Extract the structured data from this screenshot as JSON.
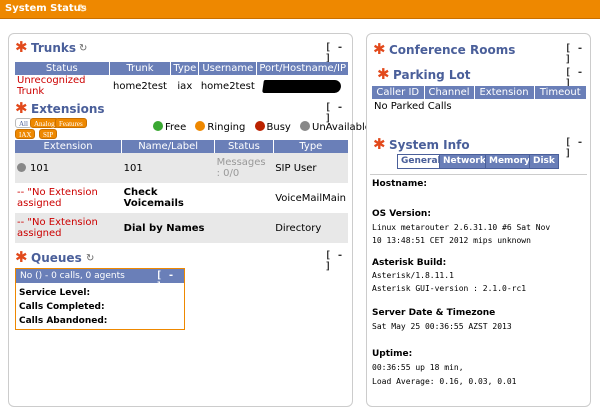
{
  "header": {
    "title": "System Status",
    "refresh_icon": "refresh-icon"
  },
  "trunks": {
    "title": "Trunks",
    "collapse_label": "[ - ]",
    "columns": [
      "Status",
      "Trunk",
      "Type",
      "Username",
      "Port/Hostname/IP"
    ],
    "rows": [
      {
        "status": "Unrecognized Trunk",
        "trunk": "home2test",
        "type": "iax",
        "username": "home2test",
        "host": ""
      }
    ],
    "status_color": "#cc0000"
  },
  "extensions": {
    "title": "Extensions",
    "collapse_label": "[ - ]",
    "filters": [
      "All",
      "Analog",
      "Features",
      "IAX",
      "SIP"
    ],
    "legend": [
      "Free",
      "Ringing",
      "Busy",
      "UnAvailable"
    ],
    "legend_colors": [
      "#3aa832",
      "#ee8800",
      "#bb2200",
      "#888888"
    ],
    "columns": [
      "Extension",
      "Name/Label",
      "Status",
      "Type"
    ],
    "rows": [
      {
        "extension": "101",
        "name": "101",
        "status": "Messages : 0/0",
        "type": "SIP User"
      },
      {
        "extension": "-- \"No Extension assigned",
        "name": "Check Voicemails",
        "status": "",
        "type": "VoiceMailMain"
      },
      {
        "extension": "-- \"No Extension assigned",
        "name": "Dial by Names",
        "status": "",
        "type": "Directory"
      }
    ]
  },
  "queues": {
    "title": "Queues",
    "collapse_label": "[ - ]",
    "summary": "No () - 0 calls, 0 agents",
    "inner_collapse": "[ - ]",
    "stats": [
      "Service Level:",
      "Calls Completed:",
      "Calls Abandoned:"
    ]
  },
  "conference": {
    "title": "Conference Rooms",
    "collapse_label": "[ - ]"
  },
  "parking": {
    "title": "Parking Lot",
    "collapse_label": "[ - ]",
    "columns": [
      "Caller ID",
      "Channel",
      "Extension",
      "Timeout"
    ],
    "empty_text": "No Parked Calls"
  },
  "sysinfo": {
    "title": "System Info",
    "collapse_label": "[ - ]",
    "tabs": [
      "General",
      "Network",
      "Memory",
      "Disk"
    ],
    "active_tab": "General",
    "hostname_label": "Hostname:",
    "hostname_value": "",
    "os_label": "OS Version:",
    "os_line1": "Linux metarouter 2.6.31.10 #6 Sat Nov",
    "os_line2": "10 13:48:51 CET 2012 mips unknown",
    "build_label": "Asterisk Build:",
    "build_line1": "Asterisk/1.8.11.1",
    "build_line2": "Asterisk GUI-version : 2.1.0-rc1",
    "date_label": "Server Date & Timezone",
    "date_value": "Sat May 25 00:36:55 AZST 2013",
    "uptime_label": "Uptime:",
    "uptime_line1": "00:36:55 up 18 min,",
    "uptime_line2": "Load Average: 0.16, 0.03, 0.01"
  }
}
